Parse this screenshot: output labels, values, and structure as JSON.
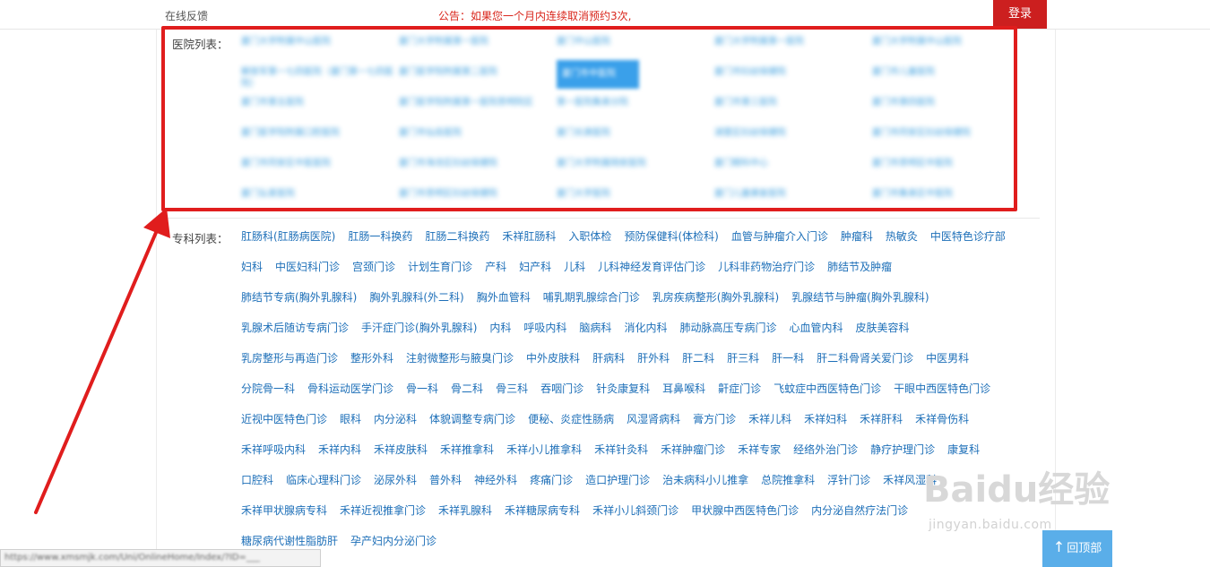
{
  "topbar": {
    "feedback": "在线反馈",
    "notice": "公告：如果您一个月内连续取消预约3次,",
    "login": "登录"
  },
  "hospital_section": {
    "label": "医院列表：",
    "items": [
      "厦门大学附属中山医院",
      "厦门大学附属第一医院",
      "厦门中山医院",
      "厦门大学附属第一医院",
      "厦门大学附属中山医院",
      "解放军第一七四医院（厦门第一七四医院）",
      "厦门医学院附属第二医院",
      "厦门市中医院",
      "厦门市妇幼保健院",
      "厦门市儿童医院",
      "厦门市第五医院",
      "厦门医学院附属第一医院思明院区",
      "第一医院集美分院",
      "厦门市第三医院",
      "厦门市第四医院",
      "厦门医学院附属口腔医院",
      "厦门市仙岳医院",
      "厦门长庚医院",
      "湖里区妇幼保健院",
      "厦门市同安区妇幼保健院",
      "厦门市同安区中医医院",
      "厦门市海沧区妇幼保健院",
      "厦门大学附属翔安医院",
      "厦门眼科中心",
      "厦门市思明区中医院",
      "厦门弘爱医院",
      "厦门市思明区妇幼保健院",
      "厦门大学医院",
      "厦门儿童康复医院",
      "厦门市集美区中医院"
    ],
    "selected_index": 7
  },
  "specialty_section": {
    "label": "专科列表：",
    "rows": [
      [
        "肛肠科(肛肠病医院)",
        "肛肠一科换药",
        "肛肠二科换药",
        "禾祥肛肠科",
        "入职体检",
        "预防保健科(体检科)",
        "血管与肿瘤介入门诊",
        "肿瘤科",
        "热敏灸",
        "中医特色诊疗部"
      ],
      [
        "妇科",
        "中医妇科门诊",
        "宫颈门诊",
        "计划生育门诊",
        "产科",
        "妇产科",
        "儿科",
        "儿科神经发育评估门诊",
        "儿科非药物治疗门诊",
        "肺结节及肿瘤"
      ],
      [
        "肺结节专病(胸外乳腺科)",
        "胸外乳腺科(外二科)",
        "胸外血管科",
        "哺乳期乳腺综合门诊",
        "乳房疾病整形(胸外乳腺科)",
        "乳腺结节与肿瘤(胸外乳腺科)"
      ],
      [
        "乳腺术后随访专病门诊",
        "手汗症门诊(胸外乳腺科)",
        "内科",
        "呼吸内科",
        "脑病科",
        "消化内科",
        "肺动脉高压专病门诊",
        "心血管内科",
        "皮肤美容科"
      ],
      [
        "乳房整形与再造门诊",
        "整形外科",
        "注射微整形与腋臭门诊",
        "中外皮肤科",
        "肝病科",
        "肝外科",
        "肝二科",
        "肝三科",
        "肝一科",
        "肝二科骨肾关爱门诊",
        "中医男科"
      ],
      [
        "分院骨一科",
        "骨科运动医学门诊",
        "骨一科",
        "骨二科",
        "骨三科",
        "吞咽门诊",
        "针灸康复科",
        "耳鼻喉科",
        "鼾症门诊",
        "飞蚊症中西医特色门诊",
        "干眼中西医特色门诊"
      ],
      [
        "近视中医特色门诊",
        "眼科",
        "内分泌科",
        "体貌调整专病门诊",
        "便秘、炎症性肠病",
        "风湿肾病科",
        "膏方门诊",
        "禾祥儿科",
        "禾祥妇科",
        "禾祥肝科",
        "禾祥骨伤科"
      ],
      [
        "禾祥呼吸内科",
        "禾祥内科",
        "禾祥皮肤科",
        "禾祥推拿科",
        "禾祥小儿推拿科",
        "禾祥针灸科",
        "禾祥肿瘤门诊",
        "禾祥专家",
        "经络外治门诊",
        "静疗护理门诊",
        "康复科"
      ],
      [
        "口腔科",
        "临床心理科门诊",
        "泌尿外科",
        "普外科",
        "神经外科",
        "疼痛门诊",
        "造口护理门诊",
        "治未病科小儿推拿",
        "总院推拿科",
        "浮针门诊",
        "禾祥风湿科"
      ],
      [
        "禾祥甲状腺病专科",
        "禾祥近视推拿门诊",
        "禾祥乳腺科",
        "禾祥糖尿病专科",
        "禾祥小儿斜颈门诊",
        "甲状腺中西医特色门诊",
        "内分泌自然疗法门诊"
      ],
      [
        "糖尿病代谢性脂肪肝",
        "孕产妇内分泌门诊"
      ]
    ]
  },
  "statusbar": {
    "url": "https://www.xmsmjk.com/Uni/OnlineHome/Index/?ID=___"
  },
  "back_to_top": {
    "label": "回顶部"
  },
  "watermark": {
    "brand": "Baidu经验",
    "sub": "jingyan.baidu.com"
  },
  "colors": {
    "annotation_red": "#e01d1d",
    "link_blue": "#1d6fb8",
    "login_red": "#cc1f1f"
  }
}
